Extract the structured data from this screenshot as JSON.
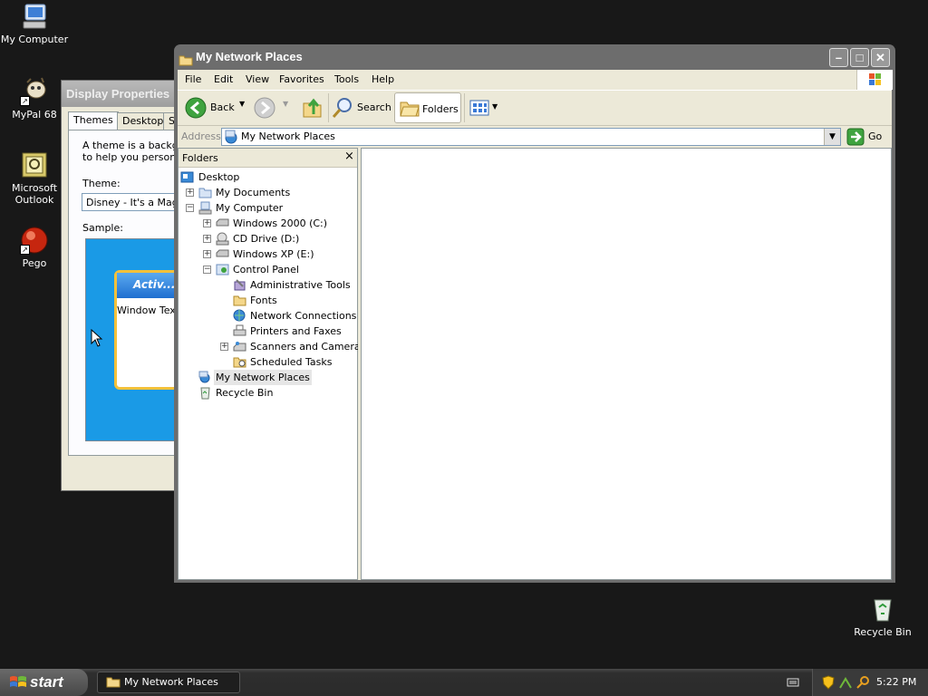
{
  "desktop": {
    "icons": [
      {
        "label": "My Computer"
      },
      {
        "label": "MyPal 68"
      },
      {
        "label": "Microsoft Outlook"
      },
      {
        "label": "Pego"
      },
      {
        "label": "Recycle Bin"
      }
    ]
  },
  "display_properties": {
    "title": "Display Properties",
    "tabs": [
      "Themes",
      "Desktop",
      "S"
    ],
    "description_line1": "A theme is a backgro",
    "description_line2": "to help you personali",
    "theme_label": "Theme:",
    "theme_value": "Disney - It's a Magica",
    "sample_label": "Sample:",
    "preview_title": "Activ...",
    "preview_text": "Window Text"
  },
  "explorer": {
    "title": "My Network Places",
    "menu": [
      "File",
      "Edit",
      "View",
      "Favorites",
      "Tools",
      "Help"
    ],
    "toolbar": {
      "back": "Back",
      "search": "Search",
      "folders": "Folders"
    },
    "address": {
      "label": "Address",
      "value": "My Network Places",
      "go": "Go"
    },
    "folders_pane": {
      "title": "Folders",
      "close": "×",
      "tree": [
        {
          "label": "Desktop"
        },
        {
          "label": "My Documents"
        },
        {
          "label": "My Computer"
        },
        {
          "label": "Windows 2000 (C:)"
        },
        {
          "label": "CD Drive (D:)"
        },
        {
          "label": "Windows XP (E:)"
        },
        {
          "label": "Control Panel"
        },
        {
          "label": "Administrative Tools"
        },
        {
          "label": "Fonts"
        },
        {
          "label": "Network Connections"
        },
        {
          "label": "Printers and Faxes"
        },
        {
          "label": "Scanners and Cameras"
        },
        {
          "label": "Scheduled Tasks"
        },
        {
          "label": "My Network Places"
        },
        {
          "label": "Recycle Bin"
        }
      ]
    }
  },
  "taskbar": {
    "start": "start",
    "task": "My Network Places",
    "time": "5:22 PM"
  },
  "colors": {
    "desktop_bg": "#181818",
    "window_frame": "#6d6d6d",
    "chrome": "#ece9d8",
    "preview_blue": "#1a9ae6"
  }
}
